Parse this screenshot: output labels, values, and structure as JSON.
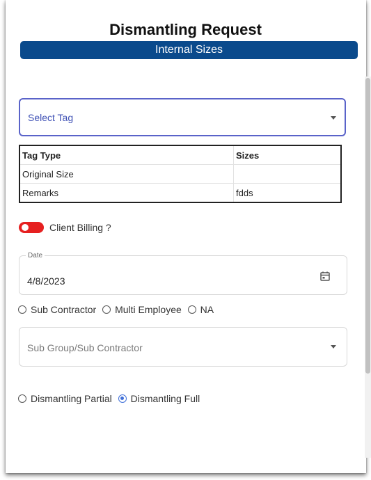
{
  "header": {
    "title": "Dismantling Request",
    "subtitle": "Internal Sizes"
  },
  "select_tag": {
    "placeholder": "Select Tag",
    "icon": "chevron-down-icon"
  },
  "tag_table": {
    "columns": [
      "Tag Type",
      "Sizes"
    ],
    "rows": [
      [
        "Original Size",
        ""
      ],
      [
        "Remarks",
        "fdds"
      ]
    ]
  },
  "client_billing": {
    "label": "Client Billing ?",
    "checked": true,
    "color": "#e62020"
  },
  "date_field": {
    "label": "Date",
    "value": "4/8/2023",
    "icon": "calendar-icon"
  },
  "assignment_options": {
    "items": [
      "Sub Contractor",
      "Multi Employee",
      "NA"
    ],
    "selected": null
  },
  "sub_group": {
    "placeholder": "Sub Group/Sub Contractor",
    "icon": "chevron-down-icon"
  },
  "dismantling_type": {
    "items": [
      "Dismantling Partial",
      "Dismantling Full"
    ],
    "selected": "Dismantling Full"
  },
  "colors": {
    "header_bar": "#0a4a8c",
    "focus_border": "#5a63c9",
    "radio_selected": "#3f6fd8"
  }
}
